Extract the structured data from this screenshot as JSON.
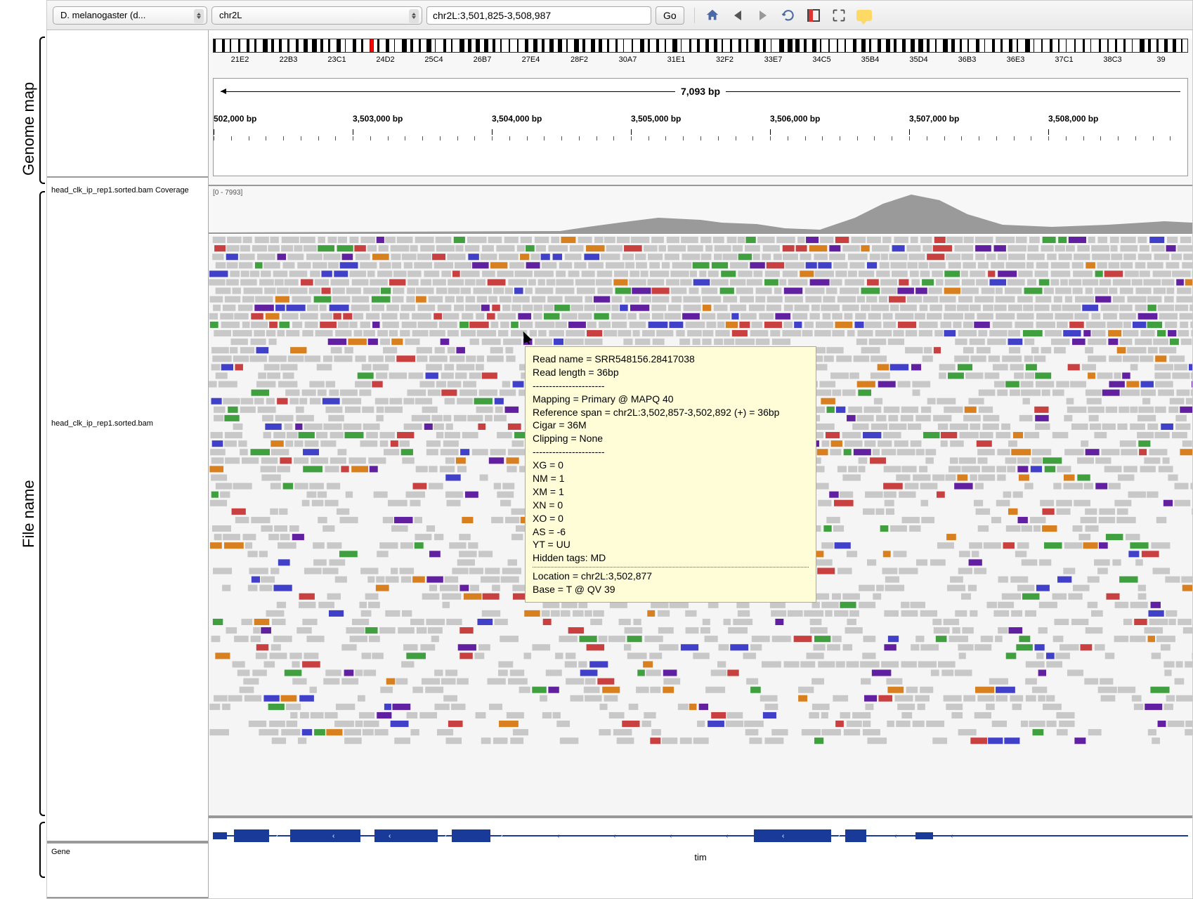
{
  "sideLabels": {
    "genome": "Genome map",
    "file": "File name"
  },
  "toolbar": {
    "genome": "D. melanogaster (d...",
    "chrom": "chr2L",
    "locus": "chr2L:3,501,825-3,508,987",
    "go": "Go"
  },
  "karyotype": {
    "markerPos": 16,
    "bands": [
      "21E2",
      "22B3",
      "23C1",
      "24D2",
      "25C4",
      "26B7",
      "27E4",
      "28F2",
      "30A7",
      "31E1",
      "32F2",
      "33E7",
      "34C5",
      "35B4",
      "35D4",
      "36B3",
      "36E3",
      "37C1",
      "38C3",
      "39"
    ]
  },
  "ruler": {
    "range": "7,093 bp",
    "ticks": [
      "502,000 bp",
      "3,503,000 bp",
      "3,504,000 bp",
      "3,505,000 bp",
      "3,506,000 bp",
      "3,507,000 bp",
      "3,508,000 bp"
    ]
  },
  "tracks": {
    "coverageName": "head_clk_ip_rep1.sorted.bam Coverage",
    "coverageScale": "[0 - 7993]",
    "readsName": "head_clk_ip_rep1.sorted.bam",
    "geneLabel": "Gene",
    "geneName": "tim"
  },
  "tooltip": {
    "lines1": [
      "Read name = SRR548156.28417038",
      "Read length = 36bp",
      "----------------------"
    ],
    "lines2": [
      "Mapping = Primary @ MAPQ 40",
      "Reference span = chr2L:3,502,857-3,502,892 (+) = 36bp",
      "Cigar = 36M",
      "Clipping = None",
      "----------------------"
    ],
    "lines3": [
      "XG = 0",
      "NM = 1",
      "XM = 1",
      "XN = 0",
      "XO = 0",
      "AS = -6",
      "YT = UU",
      "Hidden tags: MD"
    ],
    "lines4": [
      "Location = chr2L:3,502,877",
      "Base = T @ QV 39"
    ]
  }
}
